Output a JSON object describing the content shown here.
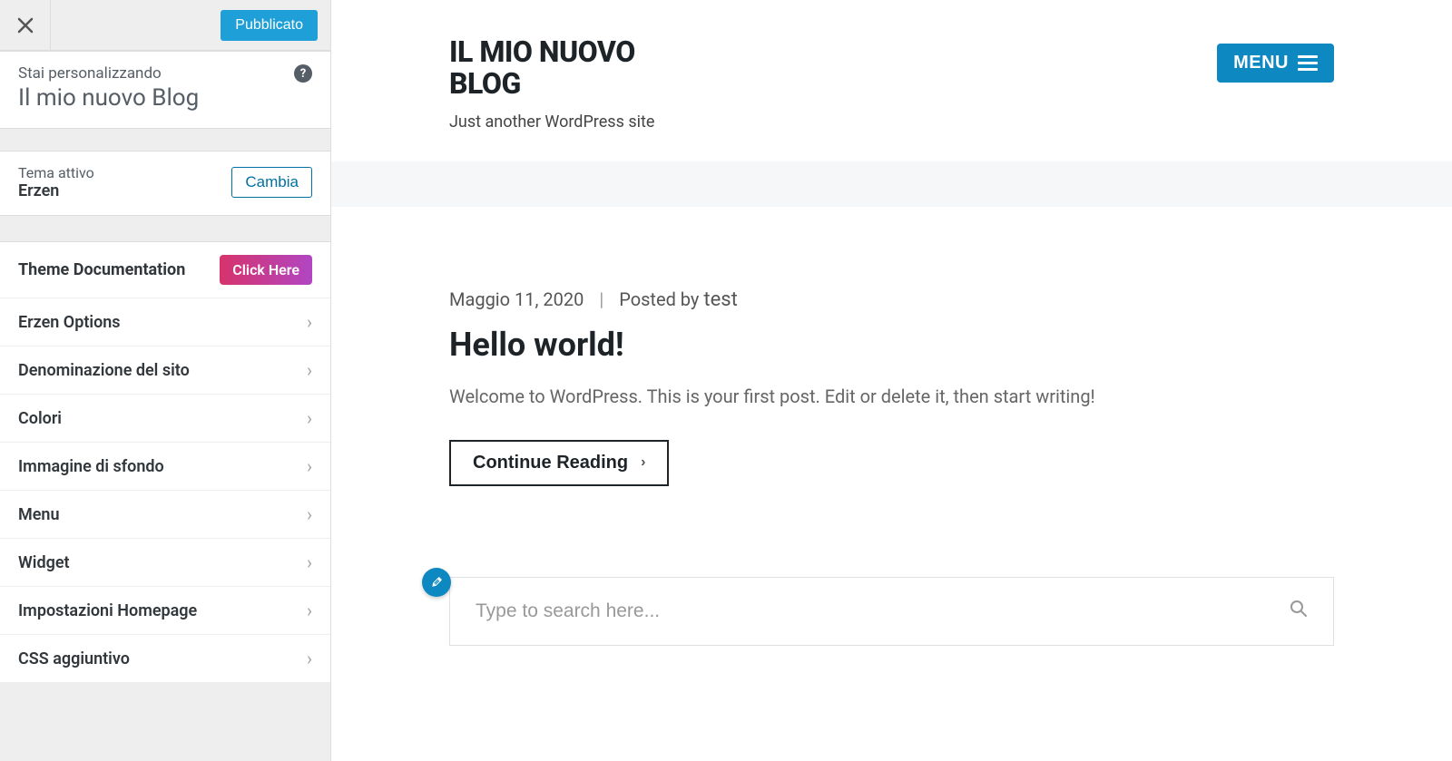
{
  "customizer": {
    "publish_label": "Pubblicato",
    "customizing_label": "Stai personalizzando",
    "site_name": "Il mio nuovo Blog",
    "active_theme_label": "Tema attivo",
    "active_theme_name": "Erzen",
    "change_label": "Cambia",
    "doc_label": "Theme Documentation",
    "doc_button": "Click Here",
    "sections": [
      {
        "label": "Erzen Options"
      },
      {
        "label": "Denominazione del sito"
      },
      {
        "label": "Colori"
      },
      {
        "label": "Immagine di sfondo"
      },
      {
        "label": "Menu"
      },
      {
        "label": "Widget"
      },
      {
        "label": "Impostazioni Homepage"
      },
      {
        "label": "CSS aggiuntivo"
      }
    ]
  },
  "preview": {
    "site_title": "IL MIO NUOVO BLOG",
    "tagline": "Just another WordPress site",
    "menu_label": "MENU",
    "post": {
      "date": "Maggio 11, 2020",
      "posted_by_label": "Posted by",
      "author": "test",
      "title": "Hello world!",
      "excerpt": "Welcome to WordPress. This is your first post. Edit or delete it, then start writing!",
      "readmore": "Continue Reading"
    },
    "search_placeholder": "Type to search here..."
  },
  "colors": {
    "accent": "#0d88c1",
    "publish": "#1e9fd7",
    "doc_gradient_from": "#d6336c",
    "doc_gradient_to": "#b146c2"
  }
}
